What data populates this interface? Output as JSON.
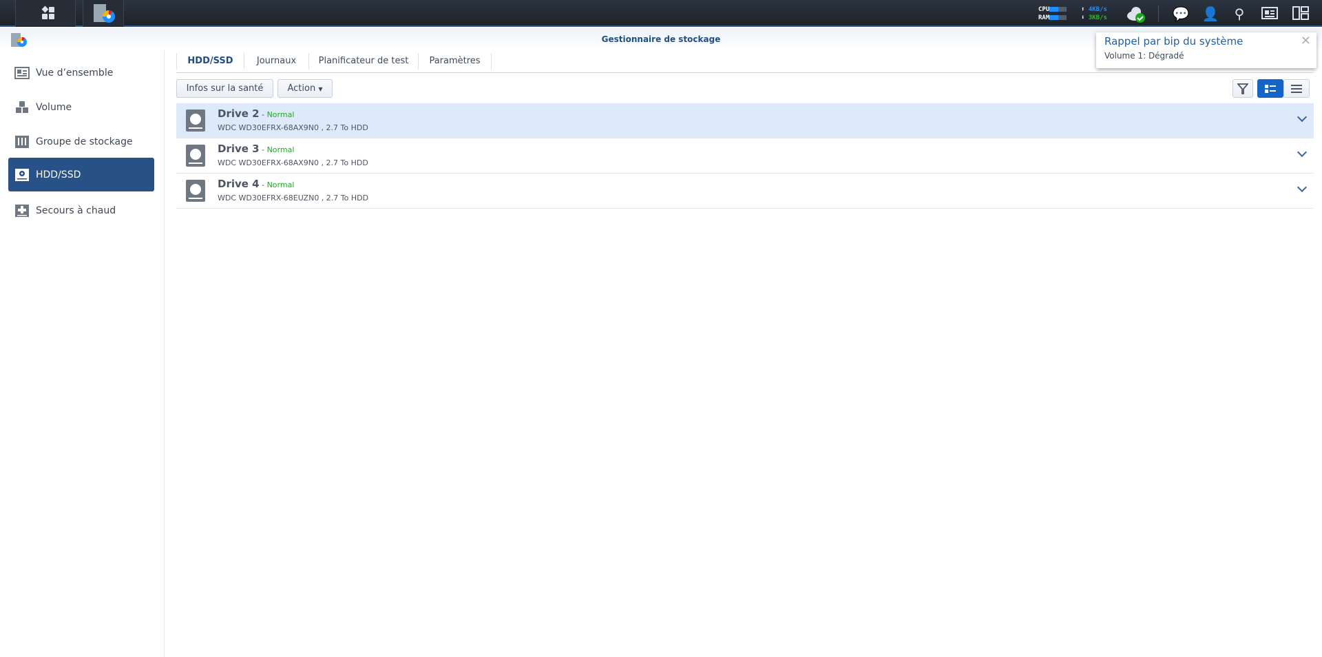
{
  "topbar": {
    "cpu_label": "CPU",
    "ram_label": "RAM",
    "upload": "4KB/s",
    "download": "3KB/s",
    "cpu_percent": 50,
    "ram_percent": 50,
    "upload_color": "#1e90ff",
    "download_color": "#24c124"
  },
  "window": {
    "title": "Gestionnaire de stockage"
  },
  "sidebar": {
    "items": [
      {
        "label": "Vue d’ensemble"
      },
      {
        "label": "Volume"
      },
      {
        "label": "Groupe de stockage"
      },
      {
        "label": "HDD/SSD"
      },
      {
        "label": "Secours à chaud"
      }
    ]
  },
  "tabs": [
    {
      "label": "HDD/SSD"
    },
    {
      "label": "Journaux"
    },
    {
      "label": "Planificateur de test"
    },
    {
      "label": "Paramètres"
    }
  ],
  "toolbar": {
    "health": "Infos sur la santé",
    "action": "Action"
  },
  "drives": [
    {
      "name": "Drive 2",
      "sep": " - ",
      "status": "Normal",
      "desc": "WDC WD30EFRX-68AX9N0 , 2.7 To HDD"
    },
    {
      "name": "Drive 3",
      "sep": " - ",
      "status": "Normal",
      "desc": "WDC WD30EFRX-68AX9N0 , 2.7 To HDD"
    },
    {
      "name": "Drive 4",
      "sep": " - ",
      "status": "Normal",
      "desc": "WDC WD30EFRX-68EUZN0 , 2.7 To HDD"
    }
  ],
  "notification": {
    "title": "Rappel par bip du système",
    "message": "Volume 1: Dégradé",
    "close": "✕"
  }
}
